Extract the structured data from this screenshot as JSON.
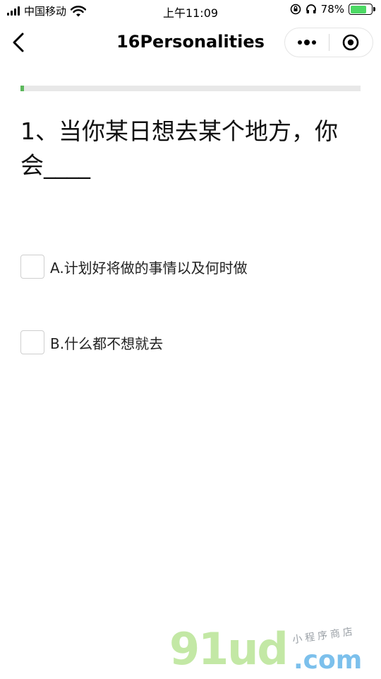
{
  "status_bar": {
    "carrier": "中国移动",
    "time": "上午11:09",
    "battery_percent_label": "78%",
    "battery_level": 0.78
  },
  "nav": {
    "title": "16Personalities",
    "back_icon": "chevron-left-icon",
    "more_icon": "more-dots-icon",
    "close_icon": "target-circle-icon"
  },
  "progress": {
    "value": 0.01,
    "track_color": "#e8e8e8",
    "fill_color": "#5cb85c"
  },
  "question": {
    "text": "1、当你某日想去某个地方，你会____"
  },
  "options": [
    {
      "label": "A.计划好将做的事情以及何时做",
      "checked": false
    },
    {
      "label": "B.什么都不想就去",
      "checked": false
    }
  ],
  "watermark": {
    "brand": "91ud",
    "domain": ".com",
    "subtitle": "小程序商店"
  }
}
